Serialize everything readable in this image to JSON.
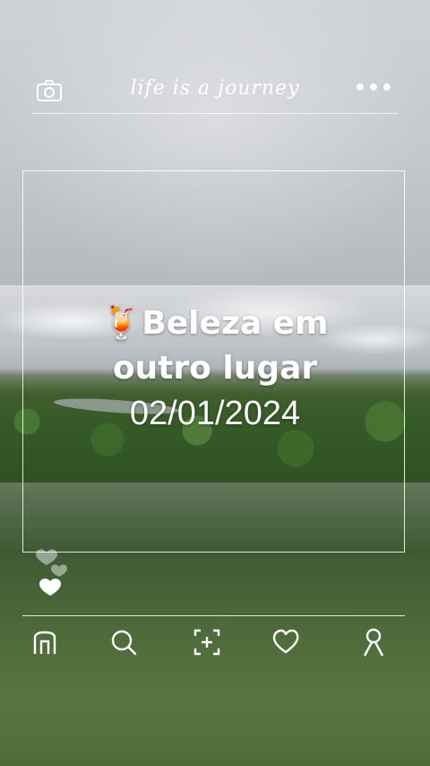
{
  "header": {
    "brand_text": "life is a journey",
    "camera_icon": "camera-icon",
    "more_icon": "more-icon",
    "more_label": "•••"
  },
  "post": {
    "emoji": "🍹",
    "title_line1": "Beleza em",
    "title_line2": "outro lugar",
    "date": "02/01/2024"
  },
  "reactions": {
    "icons": [
      "heart-icon",
      "heart-icon",
      "heart-icon"
    ]
  },
  "bottom_nav": {
    "items": [
      {
        "name": "home",
        "icon": "home-icon"
      },
      {
        "name": "search",
        "icon": "search-icon"
      },
      {
        "name": "add",
        "icon": "add-icon"
      },
      {
        "name": "likes",
        "icon": "heart-icon"
      },
      {
        "name": "profile",
        "icon": "profile-icon"
      }
    ]
  },
  "colors": {
    "foreground": "#ffffff"
  }
}
